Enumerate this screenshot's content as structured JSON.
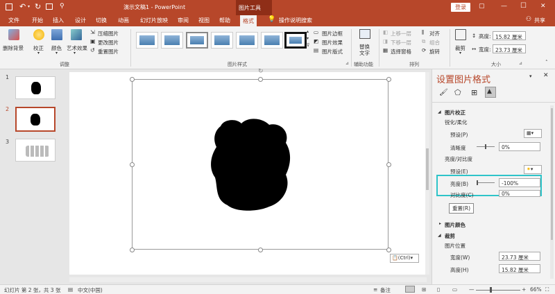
{
  "titlebar": {
    "title": "演示文稿1  -  PowerPoint",
    "context_tab": "图片工具",
    "login": "登录",
    "restore_glyph": "▢",
    "min_glyph": "—",
    "max_glyph": "☐",
    "close_glyph": "✕"
  },
  "tabs": [
    "文件",
    "开始",
    "插入",
    "设计",
    "切换",
    "动画",
    "幻灯片放映",
    "审阅",
    "视图",
    "帮助",
    "格式"
  ],
  "tell_me": "操作说明搜索",
  "share": "共享",
  "ribbon": {
    "remove_bg": "删除背景",
    "correct": "校正",
    "color": "颜色",
    "artistic": "艺术效果",
    "compress": "压缩图片",
    "change": "更改图片",
    "reset": "重置图片",
    "group_adjust": "调整",
    "border": "图片边框",
    "effects": "图片效果",
    "layout": "图片版式",
    "group_styles": "图片样式",
    "alt_text_1": "替换",
    "alt_text_2": "文字",
    "group_access": "辅助功能",
    "bring_forward": "上移一层",
    "send_backward": "下移一层",
    "selection_pane": "选择窗格",
    "align": "对齐",
    "group": "组合",
    "rotate": "旋转",
    "group_arrange": "排列",
    "crop": "裁剪",
    "height_label": "高度:",
    "height_value": "15.82 厘米",
    "width_label": "宽度:",
    "width_value": "23.73 厘米",
    "group_size": "大小"
  },
  "slides": [
    {
      "num": "1"
    },
    {
      "num": "2"
    },
    {
      "num": "3"
    }
  ],
  "paste_tag": "(Ctrl)",
  "pane": {
    "title": "设置图片格式",
    "sec_correction": "图片校正",
    "sharpen_soften": "锐化/柔化",
    "preset_p": "预设(P)",
    "sharpness": "清晰度",
    "sharpness_value": "0%",
    "brightness_contrast": "亮度/对比度",
    "preset_e": "预设(E)",
    "brightness": "亮度(B)",
    "brightness_value": "-100%",
    "contrast": "对比度(C)",
    "contrast_value": "0%",
    "reset": "重置(R)",
    "sec_color": "图片颜色",
    "sec_crop": "裁剪",
    "position": "图片位置",
    "width": "宽度(W)",
    "width_value": "23.73 厘米",
    "height": "高度(H)",
    "height_value": "15.82 厘米"
  },
  "statusbar": {
    "slide_info": "幻灯片 第 2 张，共 3 张",
    "language": "中文(中国)",
    "notes": "备注",
    "zoom": "66%"
  },
  "colors": {
    "accent": "#b7472a",
    "highlight": "#2ec4c9"
  }
}
